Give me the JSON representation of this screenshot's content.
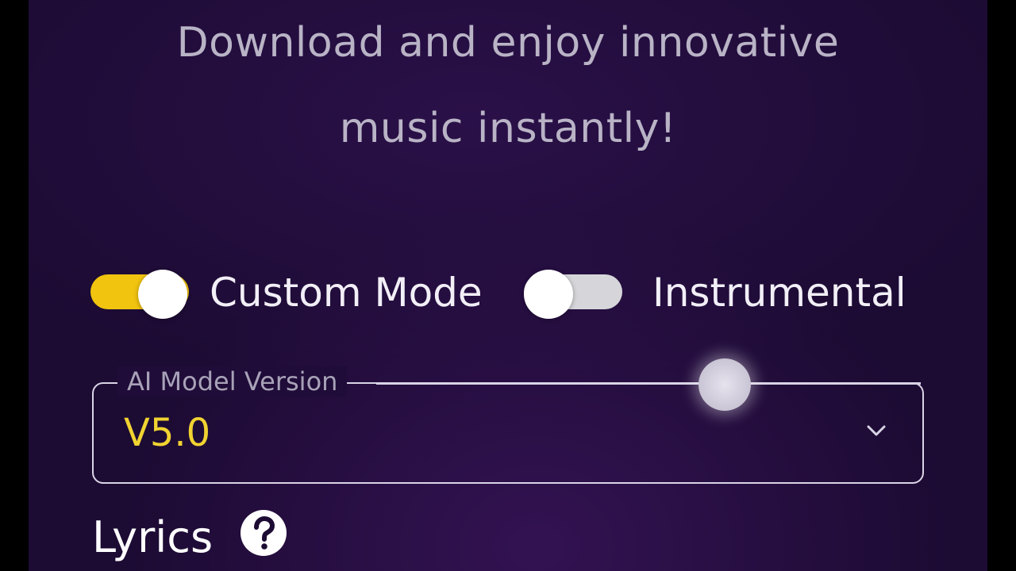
{
  "tagline": {
    "line1": "Download and enjoy innovative",
    "line2": "music instantly!"
  },
  "toggles": {
    "custom_mode": {
      "label": "Custom Mode",
      "on": true
    },
    "instrumental": {
      "label": "Instrumental",
      "on": false
    }
  },
  "model_select": {
    "label": "AI Model Version",
    "value": "V5.0"
  },
  "lyrics": {
    "label": "Lyrics",
    "help_icon": "question-circle-icon"
  },
  "colors": {
    "accent": "#f1c40f",
    "value_text": "#f1d331",
    "background": "#1c0b33"
  }
}
